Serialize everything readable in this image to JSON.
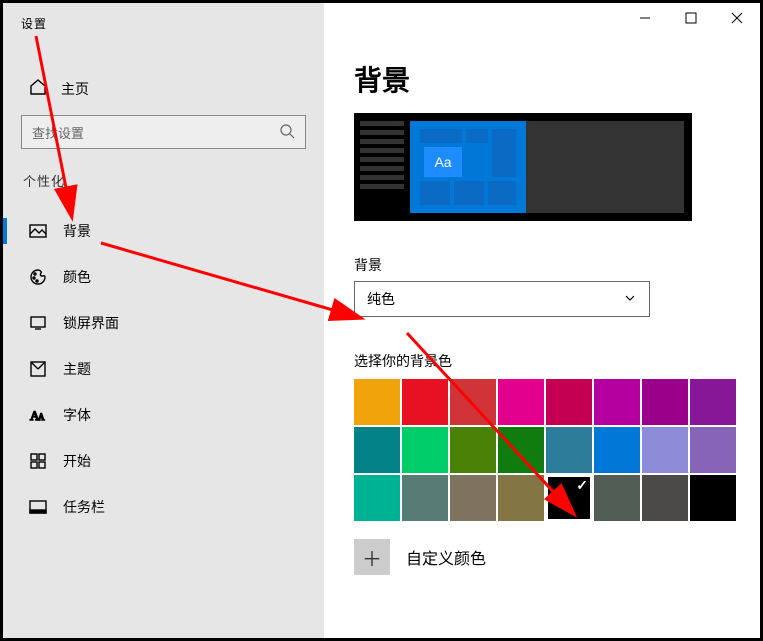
{
  "app_title": "设置",
  "window": {
    "minimize": "−",
    "maximize": "□",
    "close": "✕"
  },
  "home_label": "主页",
  "search": {
    "placeholder": "查找设置"
  },
  "section_label": "个性化",
  "nav": [
    {
      "key": "background",
      "label": "背景",
      "active": true
    },
    {
      "key": "colors",
      "label": "颜色",
      "active": false
    },
    {
      "key": "lockscreen",
      "label": "锁屏界面",
      "active": false
    },
    {
      "key": "themes",
      "label": "主题",
      "active": false
    },
    {
      "key": "fonts",
      "label": "字体",
      "active": false
    },
    {
      "key": "start",
      "label": "开始",
      "active": false
    },
    {
      "key": "taskbar",
      "label": "任务栏",
      "active": false
    }
  ],
  "page_title": "背景",
  "preview_sample_text": "Aa",
  "bg_section_label": "背景",
  "bg_dropdown_value": "纯色",
  "swatch_section_label": "选择你的背景色",
  "swatches": {
    "colors": [
      "#f0a30a",
      "#e81123",
      "#d13438",
      "#e3008c",
      "#c30052",
      "#b4009e",
      "#9a0089",
      "#881798",
      "#038387",
      "#00cc6a",
      "#498205",
      "#107c10",
      "#2d7d9a",
      "#0078d7",
      "#8e8cd8",
      "#8764b8",
      "#00b294",
      "#567c73",
      "#7e735f",
      "#847545",
      "#000000",
      "#525e54",
      "#4c4a48",
      "#000000"
    ],
    "selected_index": 20
  },
  "custom_color_label": "自定义颜色"
}
